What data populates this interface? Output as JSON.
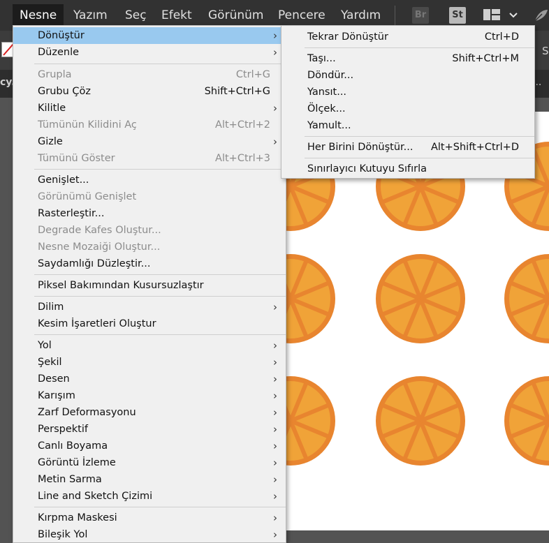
{
  "menubar": {
    "items": [
      "Nesne",
      "Yazım",
      "Seç",
      "Efekt",
      "Görünüm",
      "Pencere",
      "Yardım"
    ],
    "apps": [
      "Br",
      "St"
    ]
  },
  "workspace": {
    "tab_fragment": "cy.a",
    "more": "...",
    "right_letter": "S"
  },
  "menu": {
    "items": [
      {
        "label": "Dönüştür",
        "shortcut": "",
        "submenu": true,
        "disabled": false,
        "highlighted": true
      },
      {
        "label": "Düzenle",
        "shortcut": "",
        "submenu": true,
        "disabled": false
      },
      {
        "label": "Grupla",
        "shortcut": "Ctrl+G",
        "submenu": false,
        "disabled": true
      },
      {
        "label": "Grubu Çöz",
        "shortcut": "Shift+Ctrl+G",
        "submenu": false,
        "disabled": false
      },
      {
        "label": "Kilitle",
        "shortcut": "",
        "submenu": true,
        "disabled": false
      },
      {
        "label": "Tümünün Kilidini Aç",
        "shortcut": "Alt+Ctrl+2",
        "submenu": false,
        "disabled": true
      },
      {
        "label": "Gizle",
        "shortcut": "",
        "submenu": true,
        "disabled": false
      },
      {
        "label": "Tümünü Göster",
        "shortcut": "Alt+Ctrl+3",
        "submenu": false,
        "disabled": true
      },
      {
        "label": "Genişlet...",
        "shortcut": "",
        "submenu": false,
        "disabled": false
      },
      {
        "label": "Görünümü Genişlet",
        "shortcut": "",
        "submenu": false,
        "disabled": true
      },
      {
        "label": "Rasterleştir...",
        "shortcut": "",
        "submenu": false,
        "disabled": false
      },
      {
        "label": "Degrade Kafes Oluştur...",
        "shortcut": "",
        "submenu": false,
        "disabled": true
      },
      {
        "label": "Nesne Mozaiği Oluştur...",
        "shortcut": "",
        "submenu": false,
        "disabled": true
      },
      {
        "label": "Saydamlığı Düzleştir...",
        "shortcut": "",
        "submenu": false,
        "disabled": false
      },
      {
        "label": "Piksel Bakımından Kusursuzlaştır",
        "shortcut": "",
        "submenu": false,
        "disabled": false
      },
      {
        "label": "Dilim",
        "shortcut": "",
        "submenu": true,
        "disabled": false
      },
      {
        "label": "Kesim İşaretleri Oluştur",
        "shortcut": "",
        "submenu": false,
        "disabled": false
      },
      {
        "label": "Yol",
        "shortcut": "",
        "submenu": true,
        "disabled": false
      },
      {
        "label": "Şekil",
        "shortcut": "",
        "submenu": true,
        "disabled": false
      },
      {
        "label": "Desen",
        "shortcut": "",
        "submenu": true,
        "disabled": false
      },
      {
        "label": "Karışım",
        "shortcut": "",
        "submenu": true,
        "disabled": false
      },
      {
        "label": "Zarf Deformasyonu",
        "shortcut": "",
        "submenu": true,
        "disabled": false
      },
      {
        "label": "Perspektif",
        "shortcut": "",
        "submenu": true,
        "disabled": false
      },
      {
        "label": "Canlı Boyama",
        "shortcut": "",
        "submenu": true,
        "disabled": false
      },
      {
        "label": "Görüntü İzleme",
        "shortcut": "",
        "submenu": true,
        "disabled": false
      },
      {
        "label": "Metin Sarma",
        "shortcut": "",
        "submenu": true,
        "disabled": false
      },
      {
        "label": "Line and Sketch Çizimi",
        "shortcut": "",
        "submenu": true,
        "disabled": false
      },
      {
        "label": "Kırpma Maskesi",
        "shortcut": "",
        "submenu": true,
        "disabled": false
      },
      {
        "label": "Bileşik Yol",
        "shortcut": "",
        "submenu": true,
        "disabled": false
      }
    ]
  },
  "submenu": {
    "items": [
      {
        "label": "Tekrar Dönüştür",
        "shortcut": "Ctrl+D"
      },
      {
        "label": "Taşı...",
        "shortcut": "Shift+Ctrl+M"
      },
      {
        "label": "Döndür...",
        "shortcut": ""
      },
      {
        "label": "Yansıt...",
        "shortcut": ""
      },
      {
        "label": "Ölçek...",
        "shortcut": ""
      },
      {
        "label": "Yamult...",
        "shortcut": ""
      },
      {
        "label": "Her Birini Dönüştür...",
        "shortcut": "Alt+Shift+Ctrl+D"
      },
      {
        "label": "Sınırlayıcı Kutuyu Sıfırla",
        "shortcut": ""
      }
    ]
  },
  "colors": {
    "orange_rim": "#e8852f",
    "orange_fill": "#f0a338",
    "highlight": "#99c9ef"
  },
  "icons": {
    "submenu_arrow": "›",
    "workspace": "workspace-switcher-icon",
    "feather": "feather-icon"
  }
}
